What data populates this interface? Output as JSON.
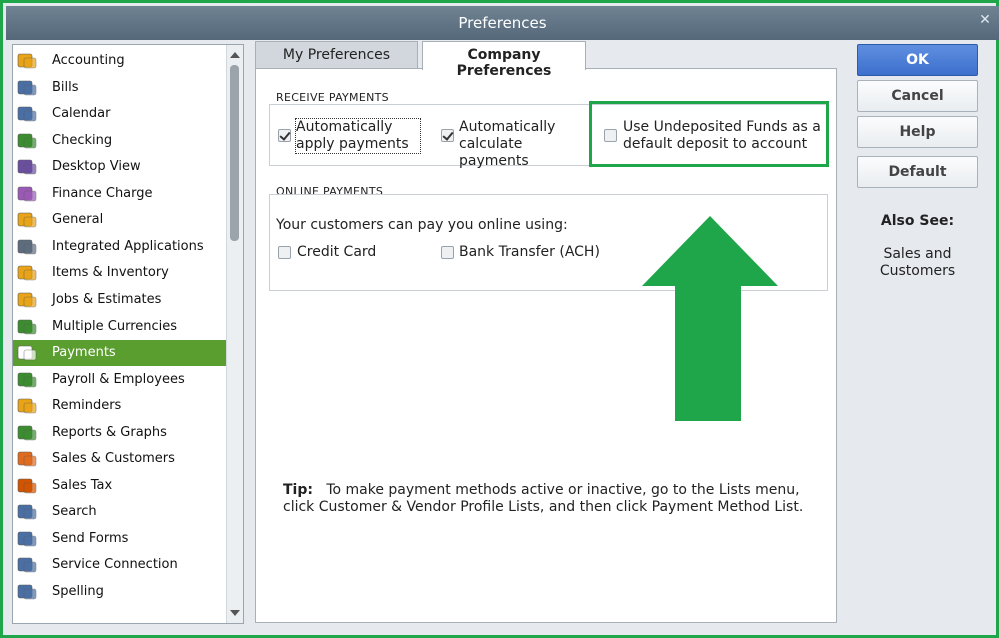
{
  "window": {
    "title": "Preferences"
  },
  "sidebar": {
    "items": [
      {
        "label": "Accounting",
        "icon": "accounting-icon"
      },
      {
        "label": "Bills",
        "icon": "bills-icon"
      },
      {
        "label": "Calendar",
        "icon": "calendar-icon"
      },
      {
        "label": "Checking",
        "icon": "checking-icon"
      },
      {
        "label": "Desktop View",
        "icon": "desktop-view-icon"
      },
      {
        "label": "Finance Charge",
        "icon": "finance-charge-icon"
      },
      {
        "label": "General",
        "icon": "general-icon"
      },
      {
        "label": "Integrated Applications",
        "icon": "integrated-apps-icon"
      },
      {
        "label": "Items & Inventory",
        "icon": "inventory-icon"
      },
      {
        "label": "Jobs & Estimates",
        "icon": "jobs-estimates-icon"
      },
      {
        "label": "Multiple Currencies",
        "icon": "currencies-icon"
      },
      {
        "label": "Payments",
        "icon": "payments-icon"
      },
      {
        "label": "Payroll & Employees",
        "icon": "payroll-icon"
      },
      {
        "label": "Reminders",
        "icon": "reminders-icon"
      },
      {
        "label": "Reports & Graphs",
        "icon": "reports-graphs-icon"
      },
      {
        "label": "Sales & Customers",
        "icon": "sales-customers-icon"
      },
      {
        "label": "Sales Tax",
        "icon": "sales-tax-icon"
      },
      {
        "label": "Search",
        "icon": "search-icon"
      },
      {
        "label": "Send Forms",
        "icon": "send-forms-icon"
      },
      {
        "label": "Service Connection",
        "icon": "service-connection-icon"
      },
      {
        "label": "Spelling",
        "icon": "spelling-icon"
      }
    ],
    "selected": "Payments"
  },
  "tabs": [
    {
      "label": "My Preferences",
      "active": false
    },
    {
      "label": "Company Preferences",
      "active": true
    }
  ],
  "receive_payments": {
    "heading": "RECEIVE PAYMENTS",
    "auto_apply": {
      "label": "Automatically apply payments",
      "checked": true
    },
    "auto_calculate": {
      "label": "Automatically calculate payments",
      "checked": true
    },
    "undeposited": {
      "label": "Use Undeposited Funds as a default deposit to account",
      "checked": false
    }
  },
  "online_payments": {
    "heading": "ONLINE PAYMENTS",
    "intro": "Your customers can pay you online using:",
    "credit_card": {
      "label": "Credit Card",
      "checked": false
    },
    "bank_transfer": {
      "label": "Bank Transfer (ACH)",
      "checked": false
    }
  },
  "tip": {
    "label": "Tip:",
    "text": "To make payment methods active or inactive, go to the Lists menu, click Customer & Vendor Profile Lists, and then click Payment Method List."
  },
  "buttons": {
    "ok": "OK",
    "cancel": "Cancel",
    "help": "Help",
    "default": "Default"
  },
  "also_see": {
    "heading": "Also See:",
    "link": "Sales and Customers"
  },
  "colors": {
    "highlight": "#1fa54a",
    "selected": "#5a9e2f",
    "primary_button": "#3d6fcd"
  }
}
